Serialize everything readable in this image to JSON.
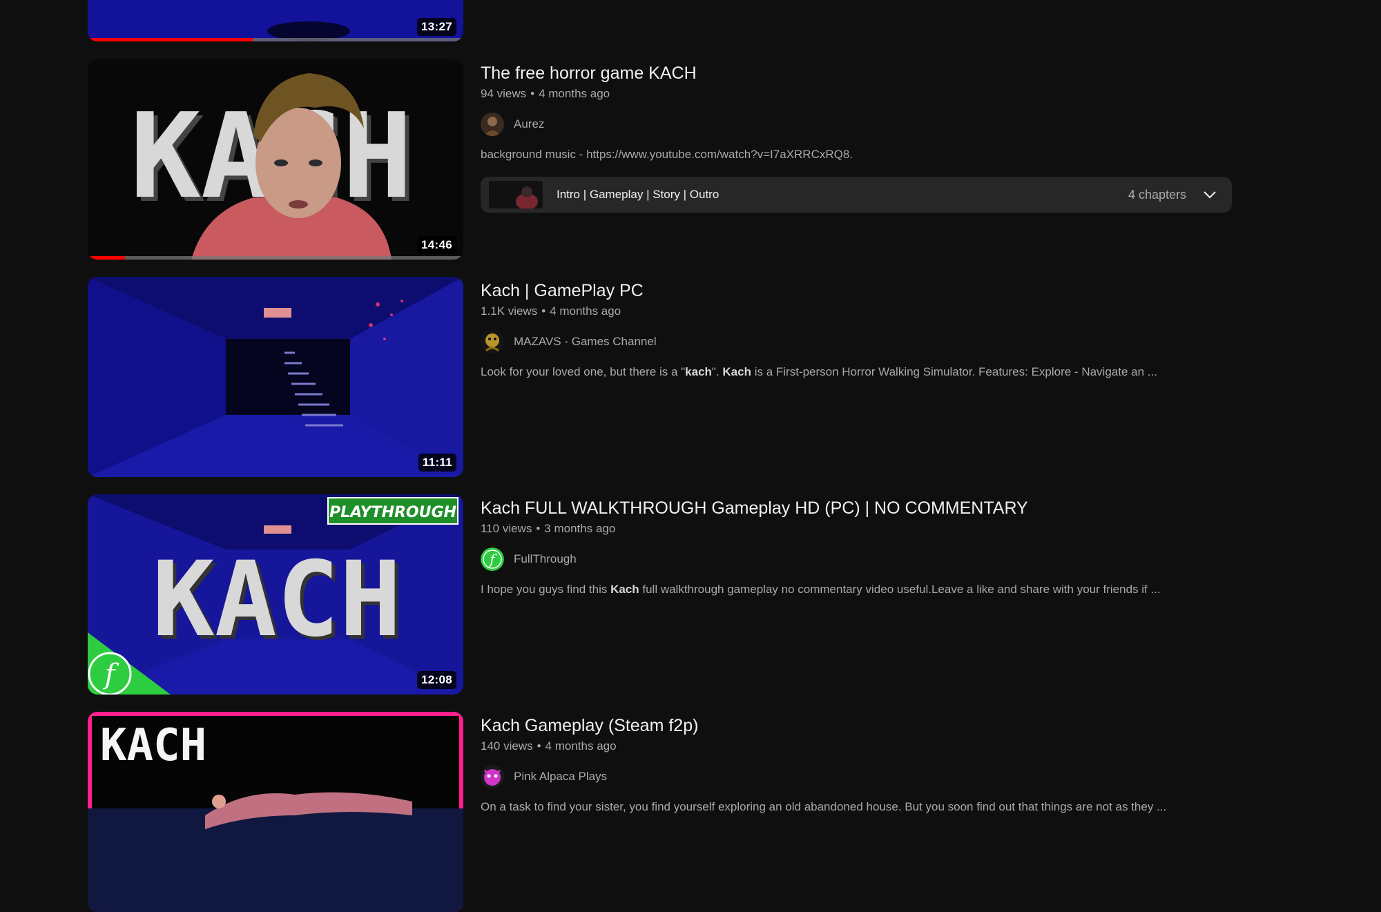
{
  "results": [
    {
      "duration": "13:27",
      "progress": 0.44
    },
    {
      "title": "The free horror game KACH",
      "views": "94 views",
      "age": "4 months ago",
      "channel": "Aurez",
      "description": "background music - https://www.youtube.com/watch?v=I7aXRRCxRQ8.",
      "chapters_text": "Intro | Gameplay | Story | Outro",
      "chapters_count": "4 chapters",
      "duration": "14:46",
      "progress": 0.1,
      "thumb_text": "KACH"
    },
    {
      "title": "Kach | GamePlay PC",
      "views": "1.1K views",
      "age": "4 months ago",
      "channel": "MAZAVS - Games Channel",
      "desc_parts": [
        "Look for your loved one, but there is a \"",
        "kach",
        "\". ",
        "Kach",
        " is a First-person Horror Walking Simulator. Features: Explore - Navigate an ..."
      ],
      "duration": "11:11"
    },
    {
      "title": "Kach FULL WALKTHROUGH Gameplay HD (PC) | NO COMMENTARY",
      "views": "110 views",
      "age": "3 months ago",
      "channel": "FullThrough",
      "desc_parts": [
        "I hope you guys find this ",
        "Kach",
        " full walkthrough gameplay no commentary video useful.Leave a like and share with your friends if ..."
      ],
      "duration": "12:08",
      "thumb_text": "KACH",
      "thumb_badge": "PLAYTHROUGH",
      "avatar_letter": "f"
    },
    {
      "title": "Kach Gameplay (Steam f2p)",
      "views": "140 views",
      "age": "4 months ago",
      "channel": "Pink Alpaca Plays",
      "description": "On a task to find your sister, you find yourself exploring an old abandoned house. But you soon find out that things are not as they ...",
      "thumb_text": "KACH"
    }
  ],
  "colors": {
    "background": "#0f0f0f",
    "progress_red": "#ff0000",
    "text_secondary": "#aaaaaa",
    "fullthrough_green": "#2ecc40",
    "pink_border": "#ff1f8e"
  },
  "icons": {
    "chapters_toggle": "chevron-down-icon"
  }
}
